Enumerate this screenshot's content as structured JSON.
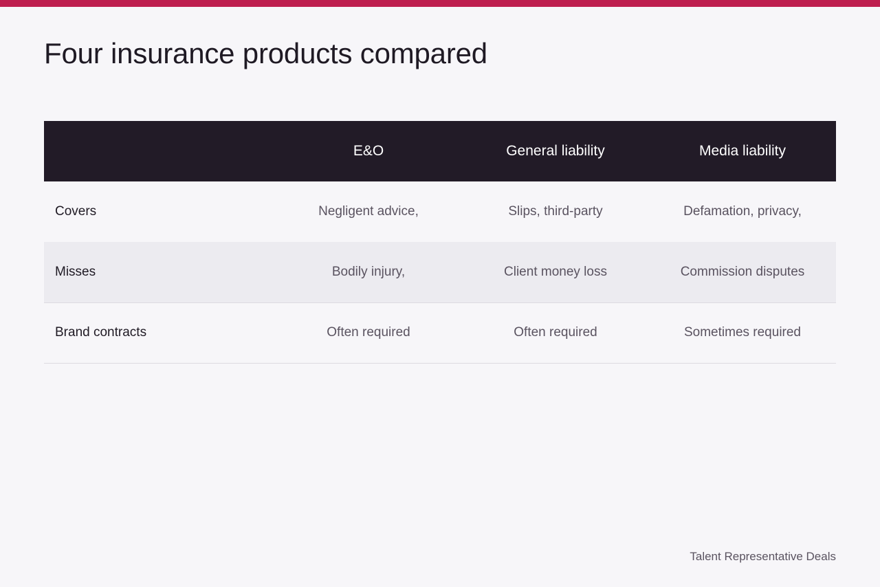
{
  "page": {
    "title": "Four insurance products compared",
    "footer": "Talent Representative Deals",
    "accent_color": "#be1e4f",
    "header_bg_color": "#221b27"
  },
  "table": {
    "headers": [
      "",
      "E&O",
      "General liability",
      "Media liability"
    ],
    "rows": [
      {
        "label": "Covers",
        "cells": [
          "Negligent advice,",
          "Slips, third-party",
          "Defamation, privacy,"
        ]
      },
      {
        "label": "Misses",
        "cells": [
          "Bodily injury,",
          "Client money loss",
          "Commission disputes"
        ]
      },
      {
        "label": "Brand contracts",
        "cells": [
          "Often required",
          "Often required",
          "Sometimes required"
        ]
      }
    ]
  }
}
